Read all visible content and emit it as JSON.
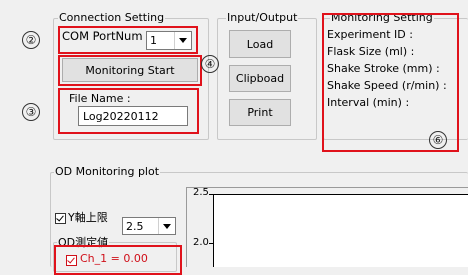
{
  "connection": {
    "group_label": "Connection Setting",
    "com_label": "COM PortNum",
    "com_value": "1",
    "monitoring_start_label": "Monitoring Start",
    "file_name_label": "File Name :",
    "file_name_value": "Log20220112"
  },
  "io": {
    "group_label": "Input/Output",
    "load_label": "Load",
    "clipboard_label": "Clipboad",
    "print_label": "Print"
  },
  "monitoring": {
    "group_label": "Monitoring Setting",
    "lines": [
      "Experiment ID :",
      "Flask Size (ml) :",
      "Shake Stroke (mm) :",
      "Shake Speed (r/min) :",
      "Interval (min) :"
    ]
  },
  "callouts": [
    "②",
    "③",
    "④",
    "⑥"
  ],
  "plot": {
    "group_label": "OD Monitoring plot",
    "y_limit_label": "Y軸上限",
    "y_limit_value": "2.5",
    "od_group_label": "OD測定値",
    "channel_label": "Ch_1 = 0.00",
    "y_ticks": [
      "2.5",
      "2.0"
    ]
  },
  "colors": {
    "highlight": "#e0121b",
    "channel": "#d0101a"
  }
}
